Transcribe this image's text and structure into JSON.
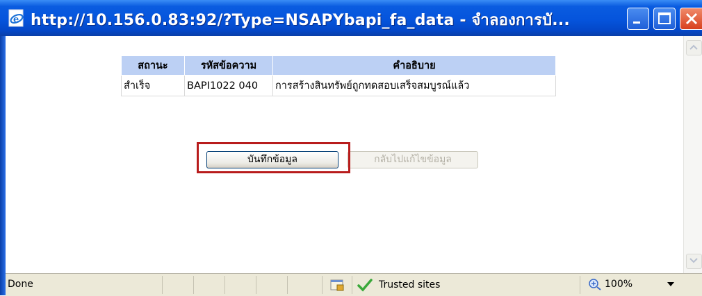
{
  "window": {
    "title": "http://10.156.0.83:92/?Type=NSAPYbapi_fa_data - จำลองการบั..."
  },
  "table": {
    "headers": [
      "สถานะ",
      "รหัสข้อความ",
      "คำอธิบาย"
    ],
    "rows": [
      [
        "สำเร็จ",
        "BAPI1022 040",
        "การสร้างสินทรัพย์ถูกทดสอบเสร็จสมบูรณ์แล้ว"
      ]
    ]
  },
  "buttons": {
    "save_label": "บันทึกข้อมูล",
    "back_label": "กลับไปแก้ไขข้อมูล"
  },
  "statusbar": {
    "status": "Done",
    "zone": "Trusted sites",
    "zoom": "100%"
  },
  "colors": {
    "title_bar": "#0554dc",
    "table_header": "#bcd0f4",
    "highlight": "#b81c1c"
  }
}
